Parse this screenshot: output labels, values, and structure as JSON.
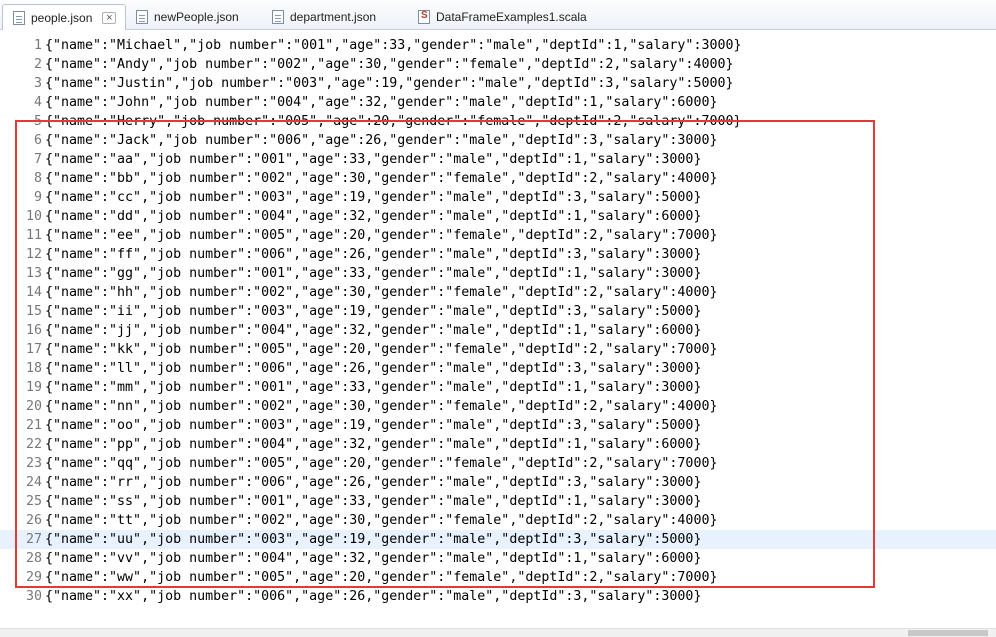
{
  "tabs": [
    {
      "label": "people.json",
      "active": true,
      "icon": "json-file-icon",
      "close": "×"
    },
    {
      "label": "newPeople.json",
      "active": false,
      "icon": "json-file-icon"
    },
    {
      "label": "department.json",
      "active": false,
      "icon": "json-file-icon"
    },
    {
      "label": "DataFrameExamples1.scala",
      "active": false,
      "icon": "scala-file-icon"
    }
  ],
  "editor": {
    "current_line": 27,
    "lines": [
      {
        "n": "1",
        "text": "{\"name\":\"Michael\",\"job number\":\"001\",\"age\":33,\"gender\":\"male\",\"deptId\":1,\"salary\":3000}"
      },
      {
        "n": "2",
        "text": "{\"name\":\"Andy\",\"job number\":\"002\",\"age\":30,\"gender\":\"female\",\"deptId\":2,\"salary\":4000}"
      },
      {
        "n": "3",
        "text": "{\"name\":\"Justin\",\"job number\":\"003\",\"age\":19,\"gender\":\"male\",\"deptId\":3,\"salary\":5000}"
      },
      {
        "n": "4",
        "text": "{\"name\":\"John\",\"job number\":\"004\",\"age\":32,\"gender\":\"male\",\"deptId\":1,\"salary\":6000}"
      },
      {
        "n": "5",
        "text": "{\"name\":\"Herry\",\"job number\":\"005\",\"age\":20,\"gender\":\"female\",\"deptId\":2,\"salary\":7000}"
      },
      {
        "n": "6",
        "text": "{\"name\":\"Jack\",\"job number\":\"006\",\"age\":26,\"gender\":\"male\",\"deptId\":3,\"salary\":3000}"
      },
      {
        "n": "7",
        "text": "{\"name\":\"aa\",\"job number\":\"001\",\"age\":33,\"gender\":\"male\",\"deptId\":1,\"salary\":3000}"
      },
      {
        "n": "8",
        "text": "{\"name\":\"bb\",\"job number\":\"002\",\"age\":30,\"gender\":\"female\",\"deptId\":2,\"salary\":4000}"
      },
      {
        "n": "9",
        "text": "{\"name\":\"cc\",\"job number\":\"003\",\"age\":19,\"gender\":\"male\",\"deptId\":3,\"salary\":5000}"
      },
      {
        "n": "10",
        "text": "{\"name\":\"dd\",\"job number\":\"004\",\"age\":32,\"gender\":\"male\",\"deptId\":1,\"salary\":6000}"
      },
      {
        "n": "11",
        "text": "{\"name\":\"ee\",\"job number\":\"005\",\"age\":20,\"gender\":\"female\",\"deptId\":2,\"salary\":7000}"
      },
      {
        "n": "12",
        "text": "{\"name\":\"ff\",\"job number\":\"006\",\"age\":26,\"gender\":\"male\",\"deptId\":3,\"salary\":3000}"
      },
      {
        "n": "13",
        "text": "{\"name\":\"gg\",\"job number\":\"001\",\"age\":33,\"gender\":\"male\",\"deptId\":1,\"salary\":3000}"
      },
      {
        "n": "14",
        "text": "{\"name\":\"hh\",\"job number\":\"002\",\"age\":30,\"gender\":\"female\",\"deptId\":2,\"salary\":4000}"
      },
      {
        "n": "15",
        "text": "{\"name\":\"ii\",\"job number\":\"003\",\"age\":19,\"gender\":\"male\",\"deptId\":3,\"salary\":5000}"
      },
      {
        "n": "16",
        "text": "{\"name\":\"jj\",\"job number\":\"004\",\"age\":32,\"gender\":\"male\",\"deptId\":1,\"salary\":6000}"
      },
      {
        "n": "17",
        "text": "{\"name\":\"kk\",\"job number\":\"005\",\"age\":20,\"gender\":\"female\",\"deptId\":2,\"salary\":7000}"
      },
      {
        "n": "18",
        "text": "{\"name\":\"ll\",\"job number\":\"006\",\"age\":26,\"gender\":\"male\",\"deptId\":3,\"salary\":3000}"
      },
      {
        "n": "19",
        "text": "{\"name\":\"mm\",\"job number\":\"001\",\"age\":33,\"gender\":\"male\",\"deptId\":1,\"salary\":3000}"
      },
      {
        "n": "20",
        "text": "{\"name\":\"nn\",\"job number\":\"002\",\"age\":30,\"gender\":\"female\",\"deptId\":2,\"salary\":4000}"
      },
      {
        "n": "21",
        "text": "{\"name\":\"oo\",\"job number\":\"003\",\"age\":19,\"gender\":\"male\",\"deptId\":3,\"salary\":5000}"
      },
      {
        "n": "22",
        "text": "{\"name\":\"pp\",\"job number\":\"004\",\"age\":32,\"gender\":\"male\",\"deptId\":1,\"salary\":6000}"
      },
      {
        "n": "23",
        "text": "{\"name\":\"qq\",\"job number\":\"005\",\"age\":20,\"gender\":\"female\",\"deptId\":2,\"salary\":7000}"
      },
      {
        "n": "24",
        "text": "{\"name\":\"rr\",\"job number\":\"006\",\"age\":26,\"gender\":\"male\",\"deptId\":3,\"salary\":3000}"
      },
      {
        "n": "25",
        "text": "{\"name\":\"ss\",\"job number\":\"001\",\"age\":33,\"gender\":\"male\",\"deptId\":1,\"salary\":3000}"
      },
      {
        "n": "26",
        "text": "{\"name\":\"tt\",\"job number\":\"002\",\"age\":30,\"gender\":\"female\",\"deptId\":2,\"salary\":4000}"
      },
      {
        "n": "27",
        "text": "{\"name\":\"uu\",\"job number\":\"003\",\"age\":19,\"gender\":\"male\",\"deptId\":3,\"salary\":5000}"
      },
      {
        "n": "28",
        "text": "{\"name\":\"vv\",\"job number\":\"004\",\"age\":32,\"gender\":\"male\",\"deptId\":1,\"salary\":6000}"
      },
      {
        "n": "29",
        "text": "{\"name\":\"ww\",\"job number\":\"005\",\"age\":20,\"gender\":\"female\",\"deptId\":2,\"salary\":7000}"
      },
      {
        "n": "30",
        "text": "{\"name\":\"xx\",\"job number\":\"006\",\"age\":26,\"gender\":\"male\",\"deptId\":3,\"salary\":3000}"
      }
    ]
  },
  "annotation": {
    "color": "#e53935"
  }
}
